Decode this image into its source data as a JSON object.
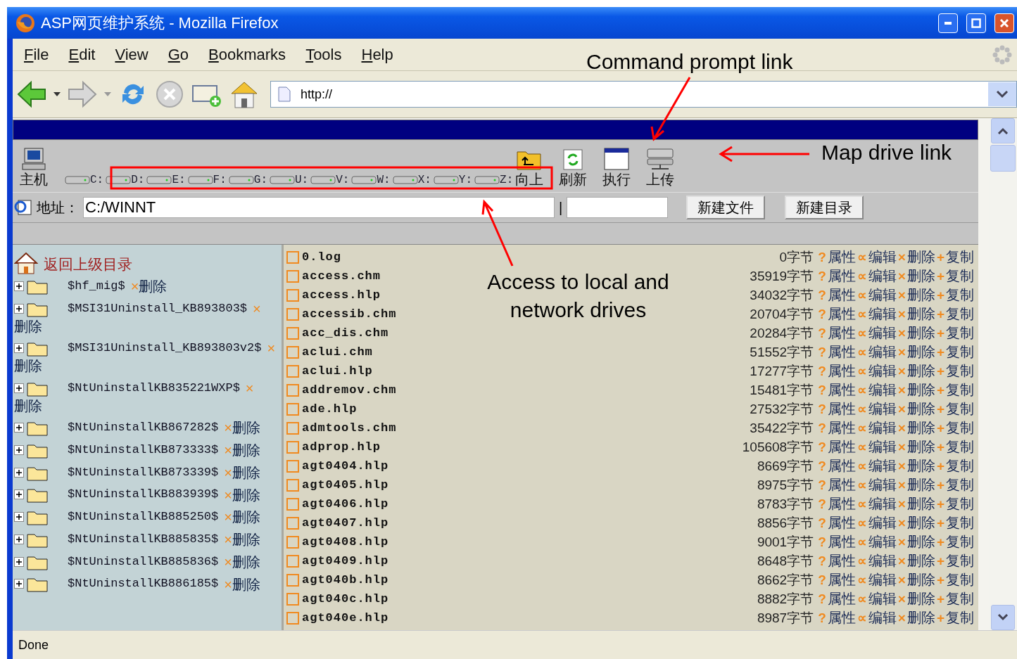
{
  "window": {
    "title": "ASP网页维护系统 - Mozilla Firefox"
  },
  "menu": [
    {
      "label": "File"
    },
    {
      "label": "Edit"
    },
    {
      "label": "View"
    },
    {
      "label": "Go"
    },
    {
      "label": "Bookmarks"
    },
    {
      "label": "Tools"
    },
    {
      "label": "Help"
    }
  ],
  "url": "http://",
  "toolbar": {
    "host": {
      "label": "主机"
    },
    "drives": [
      {
        "label": "C:"
      },
      {
        "label": "D:"
      },
      {
        "label": "E:"
      },
      {
        "label": "F:"
      },
      {
        "label": "G:"
      },
      {
        "label": "U:"
      },
      {
        "label": "V:"
      },
      {
        "label": "W:"
      },
      {
        "label": "X:"
      },
      {
        "label": "Y:"
      },
      {
        "label": "Z:"
      }
    ],
    "actions": [
      {
        "label": "向上",
        "kind": "up"
      },
      {
        "label": "刷新",
        "kind": "refresh"
      },
      {
        "label": "执行",
        "kind": "run"
      },
      {
        "label": "上传",
        "kind": "upload"
      }
    ]
  },
  "address": {
    "label": "地址：",
    "value": "C:/WINNT",
    "separator": "|"
  },
  "buttons": [
    {
      "label": "新建文件"
    },
    {
      "label": "新建目录"
    }
  ],
  "tree": {
    "parent_link": "返回上级目录",
    "folders": [
      {
        "name": "$hf_mig$",
        "expanded": false,
        "mark": "×",
        "delete": "删除"
      },
      {
        "name": "$MSI31Uninstall_KB893803$",
        "expanded": false,
        "mark": "×",
        "delete": "删除"
      },
      {
        "name": "$MSI31Uninstall_KB893803v2$",
        "expanded": false,
        "mark": "×",
        "delete": "删除"
      },
      {
        "name": "$NtUninstallKB835221WXP$",
        "expanded": false,
        "mark": "×",
        "delete": "删除"
      },
      {
        "name": "$NtUninstallKB867282$",
        "expanded": false,
        "mark": "×",
        "delete": "删除"
      },
      {
        "name": "$NtUninstallKB873333$",
        "expanded": false,
        "mark": "×",
        "delete": "删除"
      },
      {
        "name": "$NtUninstallKB873339$",
        "expanded": false,
        "mark": "×",
        "delete": "删除"
      },
      {
        "name": "$NtUninstallKB883939$",
        "expanded": false,
        "mark": "×",
        "delete": "删除"
      },
      {
        "name": "$NtUninstallKB885250$",
        "expanded": false,
        "mark": "×",
        "delete": "删除"
      },
      {
        "name": "$NtUninstallKB885835$",
        "expanded": false,
        "mark": "×",
        "delete": "删除"
      },
      {
        "name": "$NtUninstallKB885836$",
        "expanded": false,
        "mark": "×",
        "delete": "删除"
      },
      {
        "name": "$NtUninstallKB886185$",
        "expanded": false,
        "mark": "×",
        "delete": "删除"
      }
    ]
  },
  "files": [
    {
      "name": "0.log",
      "size": "0字节",
      "actions": [
        {
          "glyph": "?",
          "label": "属性"
        },
        {
          "glyph": "∝",
          "label": "编辑"
        },
        {
          "glyph": "×",
          "label": "删除"
        },
        {
          "glyph": "+",
          "label": "复制"
        }
      ]
    },
    {
      "name": "access.chm",
      "size": "35919字节",
      "actions": [
        {
          "glyph": "?",
          "label": "属性"
        },
        {
          "glyph": "∝",
          "label": "编辑"
        },
        {
          "glyph": "×",
          "label": "删除"
        },
        {
          "glyph": "+",
          "label": "复制"
        }
      ]
    },
    {
      "name": "access.hlp",
      "size": "34032字节",
      "actions": [
        {
          "glyph": "?",
          "label": "属性"
        },
        {
          "glyph": "∝",
          "label": "编辑"
        },
        {
          "glyph": "×",
          "label": "删除"
        },
        {
          "glyph": "+",
          "label": "复制"
        }
      ]
    },
    {
      "name": "accessib.chm",
      "size": "20704字节",
      "actions": [
        {
          "glyph": "?",
          "label": "属性"
        },
        {
          "glyph": "∝",
          "label": "编辑"
        },
        {
          "glyph": "×",
          "label": "删除"
        },
        {
          "glyph": "+",
          "label": "复制"
        }
      ]
    },
    {
      "name": "acc_dis.chm",
      "size": "20284字节",
      "actions": [
        {
          "glyph": "?",
          "label": "属性"
        },
        {
          "glyph": "∝",
          "label": "编辑"
        },
        {
          "glyph": "×",
          "label": "删除"
        },
        {
          "glyph": "+",
          "label": "复制"
        }
      ]
    },
    {
      "name": "aclui.chm",
      "size": "51552字节",
      "actions": [
        {
          "glyph": "?",
          "label": "属性"
        },
        {
          "glyph": "∝",
          "label": "编辑"
        },
        {
          "glyph": "×",
          "label": "删除"
        },
        {
          "glyph": "+",
          "label": "复制"
        }
      ]
    },
    {
      "name": "aclui.hlp",
      "size": "17277字节",
      "actions": [
        {
          "glyph": "?",
          "label": "属性"
        },
        {
          "glyph": "∝",
          "label": "编辑"
        },
        {
          "glyph": "×",
          "label": "删除"
        },
        {
          "glyph": "+",
          "label": "复制"
        }
      ]
    },
    {
      "name": "addremov.chm",
      "size": "15481字节",
      "actions": [
        {
          "glyph": "?",
          "label": "属性"
        },
        {
          "glyph": "∝",
          "label": "编辑"
        },
        {
          "glyph": "×",
          "label": "删除"
        },
        {
          "glyph": "+",
          "label": "复制"
        }
      ]
    },
    {
      "name": "ade.hlp",
      "size": "27532字节",
      "actions": [
        {
          "glyph": "?",
          "label": "属性"
        },
        {
          "glyph": "∝",
          "label": "编辑"
        },
        {
          "glyph": "×",
          "label": "删除"
        },
        {
          "glyph": "+",
          "label": "复制"
        }
      ]
    },
    {
      "name": "admtools.chm",
      "size": "35422字节",
      "actions": [
        {
          "glyph": "?",
          "label": "属性"
        },
        {
          "glyph": "∝",
          "label": "编辑"
        },
        {
          "glyph": "×",
          "label": "删除"
        },
        {
          "glyph": "+",
          "label": "复制"
        }
      ]
    },
    {
      "name": "adprop.hlp",
      "size": "105608字节",
      "actions": [
        {
          "glyph": "?",
          "label": "属性"
        },
        {
          "glyph": "∝",
          "label": "编辑"
        },
        {
          "glyph": "×",
          "label": "删除"
        },
        {
          "glyph": "+",
          "label": "复制"
        }
      ]
    },
    {
      "name": "agt0404.hlp",
      "size": "8669字节",
      "actions": [
        {
          "glyph": "?",
          "label": "属性"
        },
        {
          "glyph": "∝",
          "label": "编辑"
        },
        {
          "glyph": "×",
          "label": "删除"
        },
        {
          "glyph": "+",
          "label": "复制"
        }
      ]
    },
    {
      "name": "agt0405.hlp",
      "size": "8975字节",
      "actions": [
        {
          "glyph": "?",
          "label": "属性"
        },
        {
          "glyph": "∝",
          "label": "编辑"
        },
        {
          "glyph": "×",
          "label": "删除"
        },
        {
          "glyph": "+",
          "label": "复制"
        }
      ]
    },
    {
      "name": "agt0406.hlp",
      "size": "8783字节",
      "actions": [
        {
          "glyph": "?",
          "label": "属性"
        },
        {
          "glyph": "∝",
          "label": "编辑"
        },
        {
          "glyph": "×",
          "label": "删除"
        },
        {
          "glyph": "+",
          "label": "复制"
        }
      ]
    },
    {
      "name": "agt0407.hlp",
      "size": "8856字节",
      "actions": [
        {
          "glyph": "?",
          "label": "属性"
        },
        {
          "glyph": "∝",
          "label": "编辑"
        },
        {
          "glyph": "×",
          "label": "删除"
        },
        {
          "glyph": "+",
          "label": "复制"
        }
      ]
    },
    {
      "name": "agt0408.hlp",
      "size": "9001字节",
      "actions": [
        {
          "glyph": "?",
          "label": "属性"
        },
        {
          "glyph": "∝",
          "label": "编辑"
        },
        {
          "glyph": "×",
          "label": "删除"
        },
        {
          "glyph": "+",
          "label": "复制"
        }
      ]
    },
    {
      "name": "agt0409.hlp",
      "size": "8648字节",
      "actions": [
        {
          "glyph": "?",
          "label": "属性"
        },
        {
          "glyph": "∝",
          "label": "编辑"
        },
        {
          "glyph": "×",
          "label": "删除"
        },
        {
          "glyph": "+",
          "label": "复制"
        }
      ]
    },
    {
      "name": "agt040b.hlp",
      "size": "8662字节",
      "actions": [
        {
          "glyph": "?",
          "label": "属性"
        },
        {
          "glyph": "∝",
          "label": "编辑"
        },
        {
          "glyph": "×",
          "label": "删除"
        },
        {
          "glyph": "+",
          "label": "复制"
        }
      ]
    },
    {
      "name": "agt040c.hlp",
      "size": "8882字节",
      "actions": [
        {
          "glyph": "?",
          "label": "属性"
        },
        {
          "glyph": "∝",
          "label": "编辑"
        },
        {
          "glyph": "×",
          "label": "删除"
        },
        {
          "glyph": "+",
          "label": "复制"
        }
      ]
    },
    {
      "name": "agt040e.hlp",
      "size": "8987字节",
      "actions": [
        {
          "glyph": "?",
          "label": "属性"
        },
        {
          "glyph": "∝",
          "label": "编辑"
        },
        {
          "glyph": "×",
          "label": "删除"
        },
        {
          "glyph": "+",
          "label": "复制"
        }
      ]
    }
  ],
  "status": "Done",
  "annotations": [
    {
      "text": "Command prompt link",
      "kind": "command"
    },
    {
      "text": "Map drive link",
      "kind": "map"
    },
    {
      "text": "Access to local and network drives",
      "kind": "drives"
    }
  ]
}
